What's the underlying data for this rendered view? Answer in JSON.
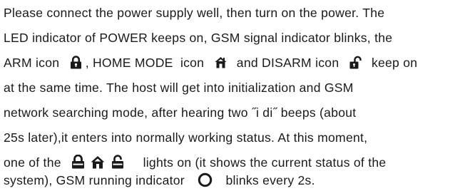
{
  "paragraph": {
    "line1": "Please connect the power supply well, then turn on the power. The",
    "line2": "LED indicator of POWER keeps on, GSM signal indicator blinks, the",
    "line3_a": "ARM icon",
    "line3_b": ", HOME MODE  icon",
    "line3_c": "and DISARM icon",
    "line3_d": "keep on",
    "line4": "at the same time. The host will get into initialization and GSM",
    "line5": "network searching mode, after hearing two ˝i di˝ beeps (about",
    "line6": "25s later),it enters into normally working status. At this moment,",
    "line7_a": "one of the",
    "line7_b": "lights on (it shows the current status of the",
    "line8_a": "system), GSM running indicator",
    "line8_b": "blinks every 2s."
  },
  "icons": {
    "arm": "locked-padlock-icon",
    "home": "home-icon",
    "disarm": "unlocked-padlock-icon",
    "gsm_running": "ring-indicator-icon"
  },
  "colors": {
    "text": "#1a1a1a",
    "icon": "#1a1a1a"
  }
}
